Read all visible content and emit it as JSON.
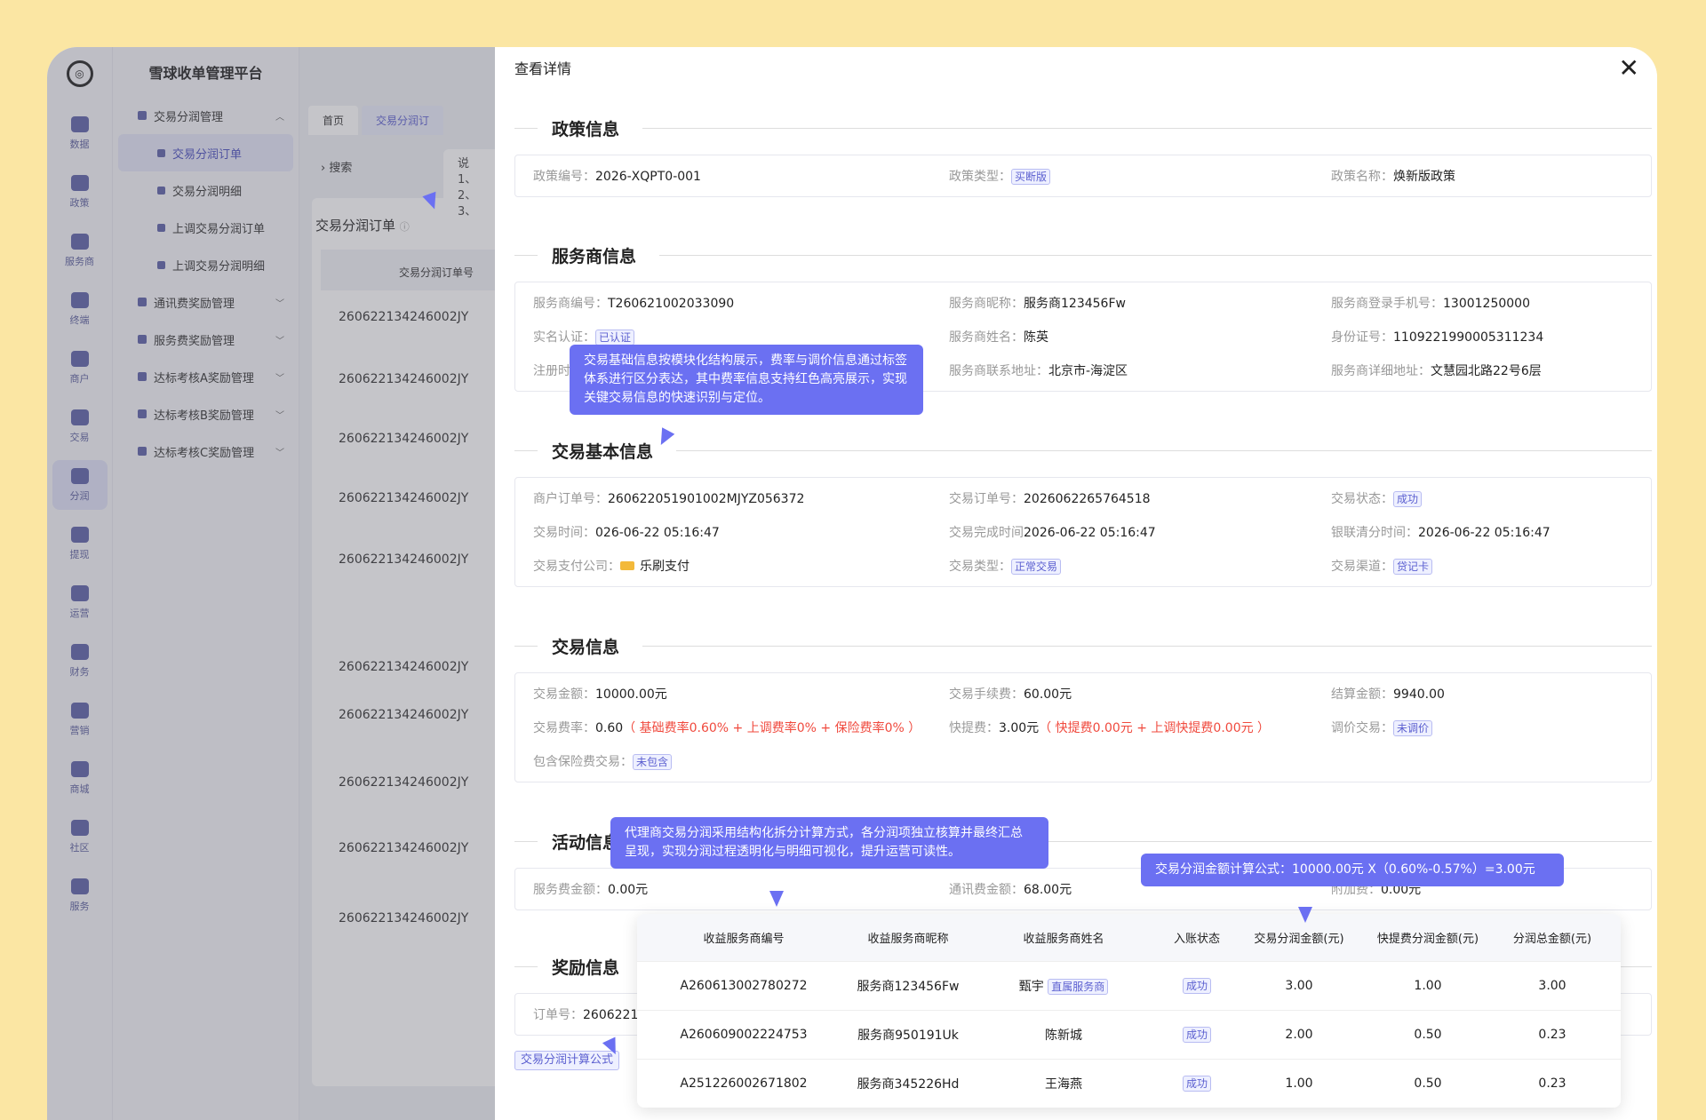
{
  "app": {
    "title": "雪球收单管理平台"
  },
  "rail": [
    {
      "label": "数据",
      "icon": "chart-icon"
    },
    {
      "label": "政策",
      "icon": "grid-icon"
    },
    {
      "label": "服务商",
      "icon": "user-icon"
    },
    {
      "label": "终端",
      "icon": "terminal-icon"
    },
    {
      "label": "商户",
      "icon": "store-icon"
    },
    {
      "label": "交易",
      "icon": "transaction-icon"
    },
    {
      "label": "分润",
      "icon": "profit-icon"
    },
    {
      "label": "提现",
      "icon": "wallet-icon"
    },
    {
      "label": "运营",
      "icon": "monitor-icon"
    },
    {
      "label": "财务",
      "icon": "shield-icon"
    },
    {
      "label": "营销",
      "icon": "gift-icon"
    },
    {
      "label": "商城",
      "icon": "shop-icon"
    },
    {
      "label": "社区",
      "icon": "chat-icon"
    },
    {
      "label": "服务",
      "icon": "service-icon"
    }
  ],
  "menu": {
    "group1": "交易分润管理",
    "subs": [
      "交易分润订单",
      "交易分润明细",
      "上调交易分润订单",
      "上调交易分润明细"
    ],
    "groups": [
      "通讯费奖励管理",
      "服务费奖励管理",
      "达标考核A奖励管理",
      "达标考核B奖励管理",
      "达标考核C奖励管理"
    ]
  },
  "bg": {
    "tab_home": "首页",
    "tab_active": "交易分润订",
    "search": "搜索",
    "tip_lines": [
      "说",
      "1、",
      "2、",
      "3、"
    ],
    "list_title": "交易分润订单",
    "list_head": "交易分润订单号",
    "rows": [
      "260622134246002JY",
      "260622134246002JY",
      "260622134246002JY",
      "260622134246002JY",
      "260622134246002JY",
      "260622134246002JY",
      "260622134246002JY",
      "260622134246002JY",
      "260622134246002JY",
      "260622134246002JY"
    ]
  },
  "drawer": {
    "title": "查看详情",
    "policy": {
      "title": "政策信息",
      "no_label": "政策编号：",
      "no": "2026-XQPT0-001",
      "type_label": "政策类型：",
      "type": "买断版",
      "name_label": "政策名称：",
      "name": "焕新版政策"
    },
    "provider": {
      "title": "服务商信息",
      "id_label": "服务商编号：",
      "id": "T260621002033090",
      "nick_label": "服务商昵称：",
      "nick": "服务商123456Fw",
      "phone_label": "服务商登录手机号：",
      "phone": "13001250000",
      "real_label": "实名认证：",
      "real": "已认证",
      "name_label": "服务商姓名：",
      "name": "陈英",
      "idcard_label": "身份证号：",
      "idcard": "1109221990005311234",
      "reg_label": "注册时间：",
      "addr_label": "服务商联系地址：",
      "addr": "北京市-海淀区",
      "addr2_label": "服务商详细地址：",
      "addr2": "文慧园北路22号6层"
    },
    "basic": {
      "title": "交易基本信息",
      "mch_order_label": "商户订单号：",
      "mch_order": "260622051901002MJYZ056372",
      "order_label": "交易订单号：",
      "order": "2026062265764518",
      "status_label": "交易状态：",
      "status": "成功",
      "time_label": "交易时间：",
      "time": "026-06-22 05:16:47",
      "done_label": "交易完成时间",
      "done": "2026-06-22 05:16:47",
      "clear_label": "银联清分时间：",
      "clear": "2026-06-22 05:16:47",
      "pay_label": "交易支付公司：",
      "pay": "乐刷支付",
      "type_label": "交易类型：",
      "type": "正常交易",
      "channel_label": "交易渠道：",
      "channel": "贷记卡"
    },
    "trade": {
      "title": "交易信息",
      "amount_label": "交易金额：",
      "amount": "10000.00元",
      "fee_label": "交易手续费：",
      "fee": "60.00元",
      "settle_label": "结算金额：",
      "settle": "9940.00",
      "rate_label": "交易费率：",
      "rate": "0.60",
      "rate_detail": "（ 基础费率0.60% + 上调费率0% + 保险费率0% ）",
      "quick_label": "快提费：",
      "quick": "3.00元",
      "quick_detail": "（ 快提费0.00元 + 上调快提费0.00元 ）",
      "adjust_label": "调价交易：",
      "adjust": "未调价",
      "ins_label": "包含保险费交易：",
      "ins": "未包含"
    },
    "activity": {
      "title": "活动信息",
      "svc_label": "服务费金额：",
      "svc": "0.00元",
      "comm_label": "通讯费金额：",
      "comm": "68.00元",
      "extra_label": "附加费：",
      "extra": "0.00元"
    },
    "reward": {
      "title": "奖励信息",
      "order_label": "订单号：",
      "order": "26062213",
      "formula_tag": "交易分润计算公式"
    }
  },
  "tips": {
    "t1": "交易基础信息按模块化结构展示，费率与调价信息通过标签体系进行区分表达，其中费率信息支持红色高亮展示，实现关键交易信息的快速识别与定位。",
    "t2": "代理商交易分润采用结构化拆分计算方式，各分润项独立核算并最终汇总呈现，实现分润过程透明化与明细可视化，提升运营可读性。",
    "t3": "交易分润金额计算公式：10000.00元 X（0.60%-0.57%）=3.00元"
  },
  "table": {
    "headers": [
      "收益服务商编号",
      "收益服务商昵称",
      "收益服务商姓名",
      "入账状态",
      "交易分润金额(元)",
      "快提费分润金额(元)",
      "分润总金额(元)"
    ],
    "rows": [
      {
        "id": "A260613002780272",
        "nick": "服务商123456Fw",
        "name": "甄宇",
        "badge": "直属服务商",
        "status": "成功",
        "profit": "3.00",
        "quick": "1.00",
        "total": "3.00"
      },
      {
        "id": "A260609002224753",
        "nick": "服务商950191Uk",
        "name": "陈新城",
        "badge": "",
        "status": "成功",
        "profit": "2.00",
        "quick": "0.50",
        "total": "0.23"
      },
      {
        "id": "A251226002671802",
        "nick": "服务商345226Hd",
        "name": "王海燕",
        "badge": "",
        "status": "成功",
        "profit": "1.00",
        "quick": "0.50",
        "total": "0.23"
      }
    ]
  }
}
